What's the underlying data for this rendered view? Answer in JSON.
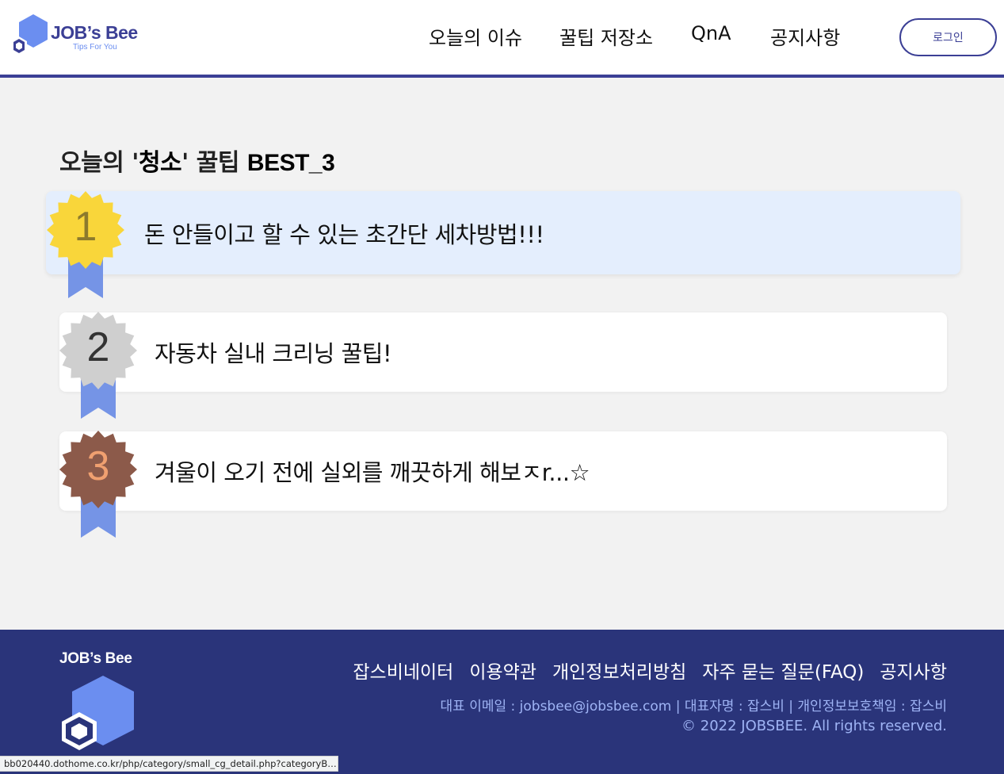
{
  "header": {
    "logo_title": "JOB’s Bee",
    "logo_subtitle": "Tips For You",
    "nav": [
      "오늘의 이슈",
      "꿀팁 저장소",
      "QnA",
      "공지사항"
    ],
    "login_label": "로그인",
    "accent_color": "#3b3f95"
  },
  "main": {
    "heading": {
      "prefix": "오늘의 '",
      "category": "청소",
      "middle": "' 꿀팁 ",
      "best": "BEST_3"
    },
    "ranking": [
      {
        "rank": "1",
        "title": "돈 안들이고 할 수 있는 초간단 세차방법!!!",
        "badge_color": "#f9d63a",
        "number_color": "#8c7a2d"
      },
      {
        "rank": "2",
        "title": "자동차 실내 크리닝 꿀팁!",
        "badge_color": "#cfcfcf",
        "number_color": "#333333"
      },
      {
        "rank": "3",
        "title": "겨울이 오기 전에 실외를 깨끗하게 해보ㅈr...☆",
        "badge_color": "#8c5a4a",
        "number_color": "#f0a070"
      }
    ],
    "ribbon_color": "#7594e6"
  },
  "footer": {
    "logo_title": "JOB’s Bee",
    "links": [
      "잡스비네이터",
      "이용약관",
      "개인정보처리방침",
      "자주 묻는 질문(FAQ)",
      "공지사항"
    ],
    "info": "대표 이메일 : jobsbee@jobsbee.com | 대표자명 : 잡스비 | 개인정보보호책임 : 잡스비",
    "copyright": "© 2022 JOBSBEE. All rights reserved.",
    "background_color": "#2a347a"
  },
  "status_bar": {
    "url": "bb020440.dothome.co.kr/php/category/small_cg_detail.php?categoryBig=..."
  }
}
